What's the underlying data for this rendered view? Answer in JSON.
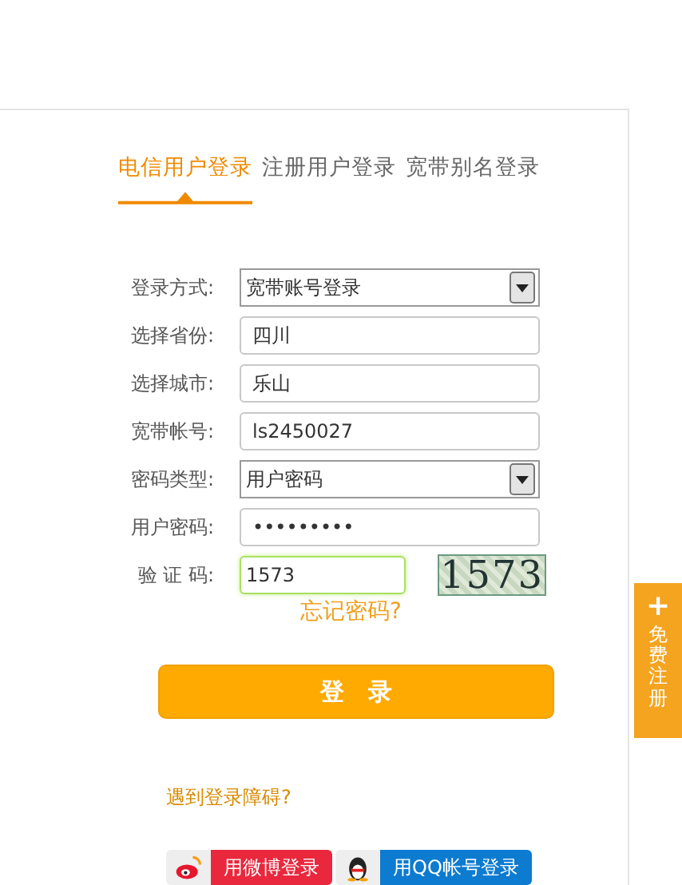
{
  "tabs": [
    {
      "label": "电信用户登录",
      "selected": true
    },
    {
      "label": "注册用户登录",
      "selected": false
    },
    {
      "label": "宽带别名登录",
      "selected": false
    }
  ],
  "form": [
    {
      "label": "登录方式:",
      "kind": "select",
      "value": "宽带账号登录"
    },
    {
      "label": "选择省份:",
      "kind": "text",
      "value": "四川"
    },
    {
      "label": "选择城市:",
      "kind": "text",
      "value": "乐山"
    },
    {
      "label": "宽带帐号:",
      "kind": "text",
      "value": "ls2450027"
    },
    {
      "label": "密码类型:",
      "kind": "select",
      "value": "用户密码"
    },
    {
      "label": "用户密码:",
      "kind": "password",
      "value": "•••••••••"
    },
    {
      "label": "验 证 码:",
      "kind": "captcha",
      "value": "1573",
      "focused": true,
      "captcha_image": "1573"
    }
  ],
  "forgot_link": "忘记密码?",
  "login_button": "登　录",
  "help_link": "遇到登录障碍?",
  "social": [
    {
      "kind": "weibo",
      "label": "用微博登录"
    },
    {
      "kind": "qq",
      "label": "用QQ帐号登录"
    }
  ],
  "side_tab": {
    "plus": "+",
    "label": "免费注册"
  }
}
